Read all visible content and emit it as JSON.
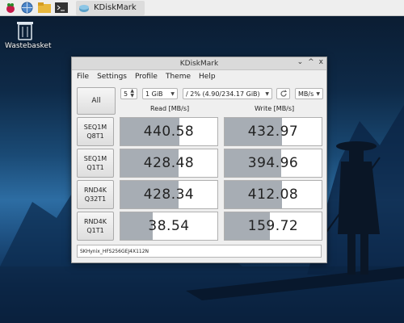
{
  "taskbar": {
    "task_title": "KDiskMark"
  },
  "desktop": {
    "wastebasket_label": "Wastebasket"
  },
  "window": {
    "title": "KDiskMark",
    "controls": [
      "⌄",
      "^",
      "x"
    ],
    "menu": [
      "File",
      "Settings",
      "Profile",
      "Theme",
      "Help"
    ],
    "all_button": "All",
    "loops": "5",
    "size": "1 GiB",
    "location": "/ 2% (4.90/234.17 GiB)",
    "unit": "MB/s",
    "read_header": "Read [MB/s]",
    "write_header": "Write [MB/s]",
    "rows": [
      {
        "line1": "SEQ1M",
        "line2": "Q8T1",
        "read": "440.58",
        "write": "432.97",
        "read_fill": 0.61,
        "write_fill": 0.59
      },
      {
        "line1": "SEQ1M",
        "line2": "Q1T1",
        "read": "428.48",
        "write": "394.96",
        "read_fill": 0.6,
        "write_fill": 0.58
      },
      {
        "line1": "RND4K",
        "line2": "Q32T1",
        "read": "428.34",
        "write": "412.08",
        "read_fill": 0.6,
        "write_fill": 0.59
      },
      {
        "line1": "RND4K",
        "line2": "Q1T1",
        "read": "38.54",
        "write": "159.72",
        "read_fill": 0.33,
        "write_fill": 0.47
      }
    ],
    "status": "SKHynix_HFS256GEJ4X112N"
  }
}
